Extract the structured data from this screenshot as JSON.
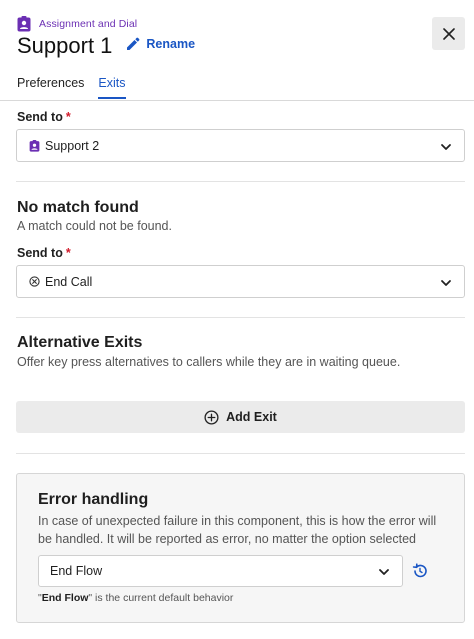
{
  "header": {
    "breadcrumb": "Assignment and Dial",
    "title": "Support 1",
    "rename_label": "Rename"
  },
  "tabs": [
    {
      "label": "Preferences",
      "active": false
    },
    {
      "label": "Exits",
      "active": true
    }
  ],
  "send_to_1": {
    "label": "Send to",
    "required": "*",
    "value": "Support 2",
    "icon": "badge-icon"
  },
  "no_match": {
    "title": "No match found",
    "description": "A match could not be found.",
    "send_label": "Send to",
    "required": "*",
    "value": "End Call",
    "icon": "circle-x-icon"
  },
  "alternative_exits": {
    "title": "Alternative Exits",
    "description": "Offer key press alternatives to callers while they are in waiting queue.",
    "add_label": "Add Exit"
  },
  "error_handling": {
    "title": "Error handling",
    "description": "In case of unexpected failure in this component, this is how the error will be handled. It will be reported as error, no matter the option selected",
    "value": "End Flow",
    "note_quote_open": "\"",
    "note_bold": "End Flow",
    "note_rest": "\" is the current default behavior"
  },
  "colors": {
    "accent": "#1a56c4",
    "brand_purple": "#6b2fb3",
    "required": "#d11a2a"
  }
}
